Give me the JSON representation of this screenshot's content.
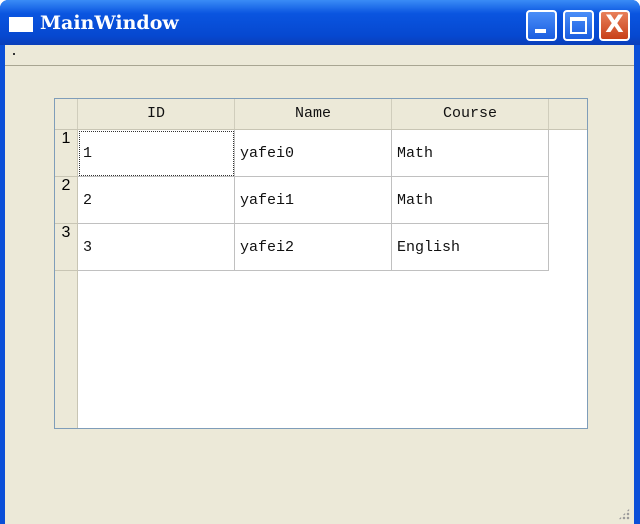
{
  "window": {
    "title": "MainWindow",
    "minimize": "_",
    "maximize": "□",
    "close": "X"
  },
  "table": {
    "columns": [
      "ID",
      "Name",
      "Course"
    ],
    "row_headers": [
      "1",
      "2",
      "3"
    ],
    "rows": [
      [
        "1",
        "yafei0",
        "Math"
      ],
      [
        "2",
        "yafei1",
        "Math"
      ],
      [
        "3",
        "yafei2",
        "English"
      ]
    ]
  },
  "colors": {
    "titlebar": "#0a55e0",
    "client": "#ece9d8"
  }
}
